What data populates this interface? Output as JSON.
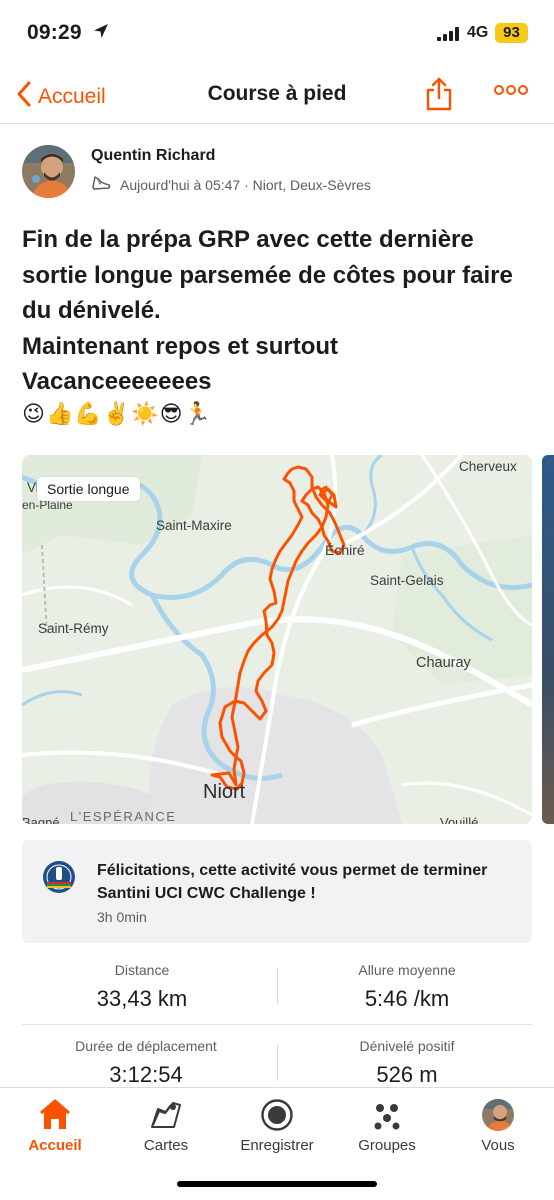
{
  "status_bar": {
    "time": "09:29",
    "network": "4G",
    "battery": "93"
  },
  "nav": {
    "back_label": "Accueil",
    "title": "Course à pied"
  },
  "author": {
    "name": "Quentin Richard",
    "meta": "Aujourd'hui à 05:47 · Niort, Deux-Sèvres"
  },
  "description": {
    "paragraphs": [
      "Fin de la prépa GRP avec cette dernière sortie longue parsemée de côtes pour faire du dénivelé.",
      "Maintenant repos et surtout Vacanceeeeeees"
    ],
    "emojis": [
      "😉",
      "👍",
      "💪",
      "✌️",
      "☀️",
      "😎",
      "🏃"
    ]
  },
  "map": {
    "badge": "Sortie longue",
    "places": {
      "cherveux": "Cherveux",
      "vil": "Vil",
      "en_plaine": "en-Plaine",
      "saint_maxire": "Saint-Maxire",
      "echire": "Échiré",
      "saint_gelais": "Saint-Gelais",
      "saint_remy": "Saint-Rémy",
      "chauray": "Chauray",
      "niort": "Niort",
      "esperance": "L'ESPÉRANCE",
      "bagne": "Bagné",
      "vouille": "Vouillé"
    }
  },
  "achievement": {
    "text": "Félicitations, cette activité vous permet de terminer Santini UCI CWC Challenge !",
    "duration": "3h 0min"
  },
  "stats": [
    {
      "label": "Distance",
      "value": "33,43 km"
    },
    {
      "label": "Allure moyenne",
      "value": "5:46 /km"
    },
    {
      "label": "Durée de déplacement",
      "value": "3:12:54"
    },
    {
      "label": "Dénivelé positif",
      "value": "526 m"
    }
  ],
  "tabs": [
    {
      "label": "Accueil"
    },
    {
      "label": "Cartes"
    },
    {
      "label": "Enregistrer"
    },
    {
      "label": "Groupes"
    },
    {
      "label": "Vous"
    }
  ],
  "colors": {
    "accent": "#fc5200",
    "route": "#fc5200",
    "map_bg": "#e8eee4",
    "water": "#a9d3ea",
    "achievement_bg": "#f2f2f4"
  },
  "icons": [
    "location-arrow-icon",
    "chevron-left-icon",
    "share-icon",
    "more-icon",
    "shoe-icon",
    "home-icon",
    "map-icon",
    "record-icon",
    "groups-icon"
  ]
}
